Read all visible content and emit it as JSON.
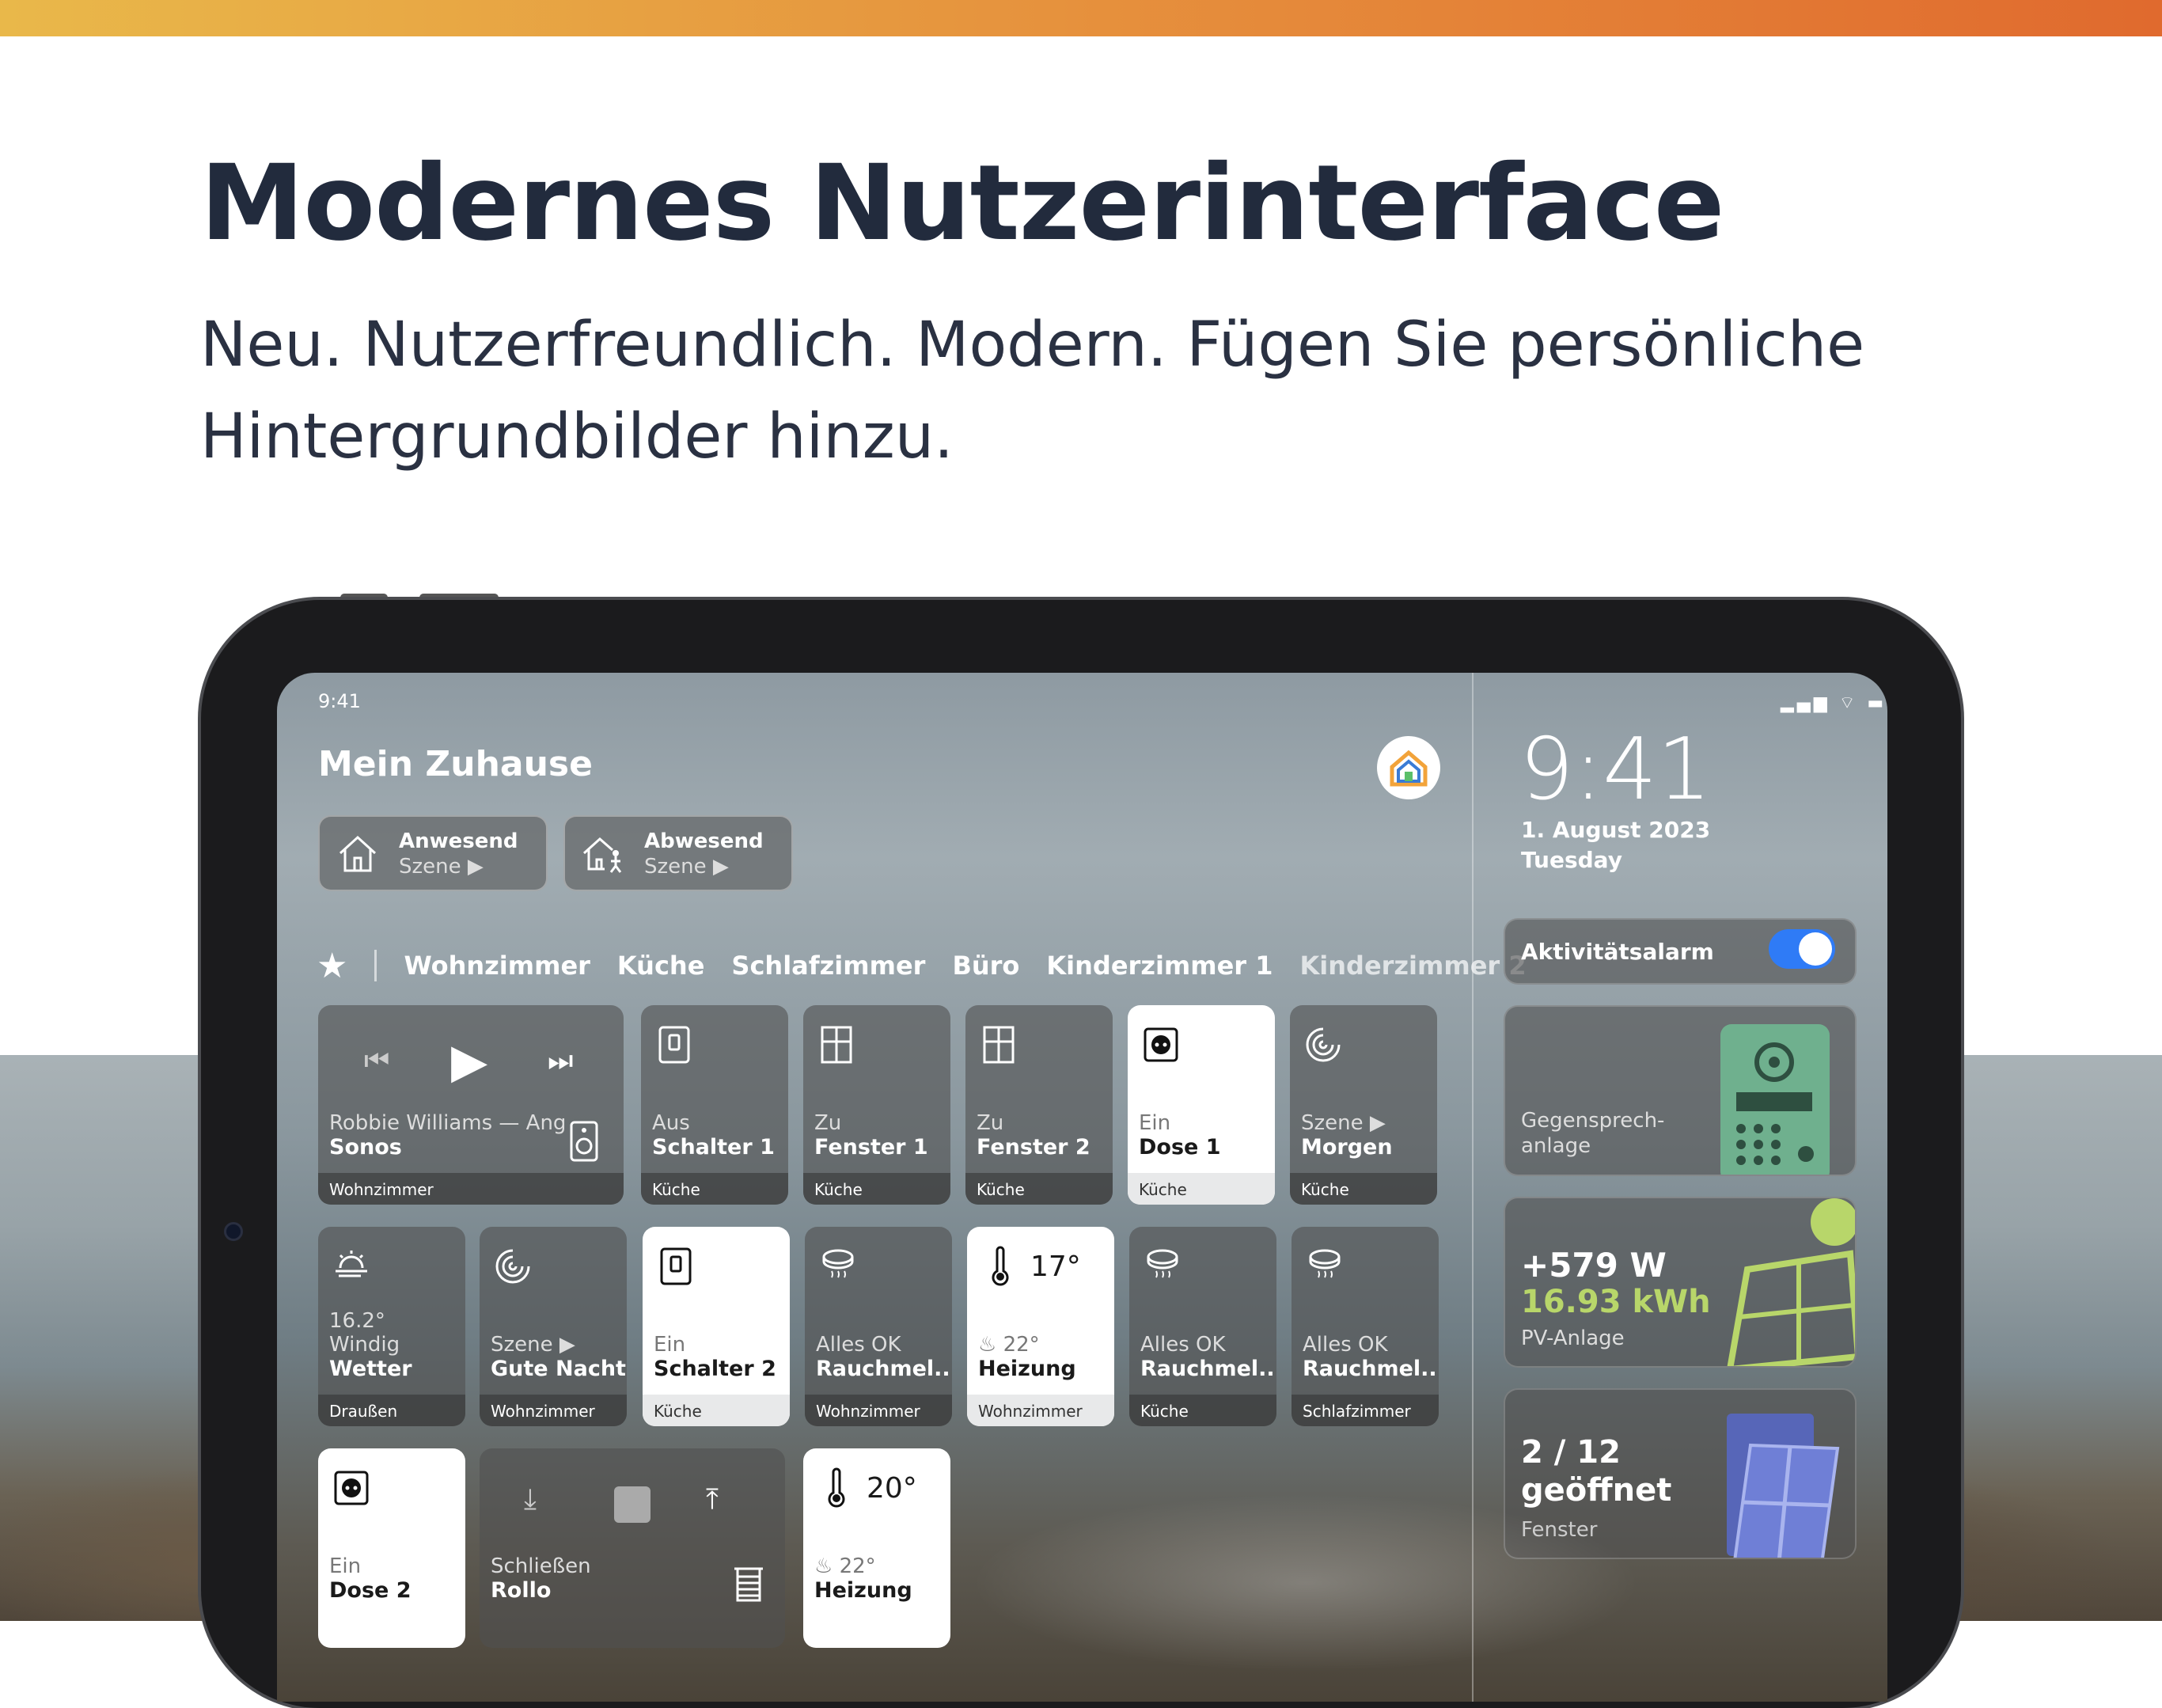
{
  "page": {
    "headline": "Modernes Nutzerinterface",
    "subline": "Neu. Nutzerfreundlich. Modern. Fügen Sie persönliche Hintergrundbilder hinzu."
  },
  "status": {
    "time": "9:41",
    "icons": "▂▄▆ ⌔ ▬"
  },
  "home": {
    "title": "Mein Zuhause"
  },
  "scenes": [
    {
      "title": "Anwesend",
      "sub": "Szene ▶"
    },
    {
      "title": "Abwesend",
      "sub": "Szene ▶"
    }
  ],
  "rooms": {
    "star": "★",
    "items": [
      "Wohnzimmer",
      "Küche",
      "Schlafzimmer",
      "Büro",
      "Kinderzimmer 1",
      "Kinderzimmer 2"
    ]
  },
  "tiles": {
    "sonos": {
      "track": "Robbie Williams — Ang",
      "name": "Sonos",
      "room": "Wohnzimmer"
    },
    "schalter1": {
      "state": "Aus",
      "name": "Schalter 1",
      "room": "Küche"
    },
    "fenster1": {
      "state": "Zu",
      "name": "Fenster 1",
      "room": "Küche"
    },
    "fenster2": {
      "state": "Zu",
      "name": "Fenster 2",
      "room": "Küche"
    },
    "dose1": {
      "state": "Ein",
      "name": "Dose 1",
      "room": "Küche"
    },
    "morgen": {
      "state": "Szene ▶",
      "name": "Morgen",
      "room": "Küche"
    },
    "wetter": {
      "temp": "16.2°",
      "state": "Windig",
      "name": "Wetter",
      "room": "Draußen"
    },
    "nacht": {
      "state": "Szene ▶",
      "name": "Gute Nacht",
      "room": "Wohnzimmer"
    },
    "schalter2": {
      "state": "Ein",
      "name": "Schalter 2",
      "room": "Küche"
    },
    "rauch1": {
      "state": "Alles OK",
      "name": "Rauchmel...",
      "room": "Wohnzimmer"
    },
    "heizung1": {
      "temp": "17°",
      "state": "♨ 22°",
      "name": "Heizung",
      "room": "Wohnzimmer"
    },
    "rauch2": {
      "state": "Alles OK",
      "name": "Rauchmel...",
      "room": "Küche"
    },
    "rauch3": {
      "state": "Alles OK",
      "name": "Rauchmel...",
      "room": "Schlafzimmer"
    },
    "dose2": {
      "state": "Ein",
      "name": "Dose 2"
    },
    "rollo": {
      "state": "Schließen",
      "name": "Rollo"
    },
    "heizung2": {
      "temp": "20°",
      "state": "♨ 22°",
      "name": "Heizung"
    }
  },
  "right": {
    "time": "9:41",
    "date": "1. August 2023",
    "day": "Tuesday",
    "alarm": "Aktivitätsalarm",
    "intercom": "Gegensprech-\nanlage",
    "pv": {
      "watt": "+579 W",
      "kwh": "16.93 kWh",
      "label": "PV-Anlage"
    },
    "windows": {
      "count": "2 / 12",
      "state": "geöffnet",
      "label": "Fenster"
    }
  },
  "colors": {
    "accent": "#2f7bf6",
    "pv_green": "#b8d66a",
    "intercom_green": "#6fb08e",
    "window_blue": "#6f7fd6"
  }
}
